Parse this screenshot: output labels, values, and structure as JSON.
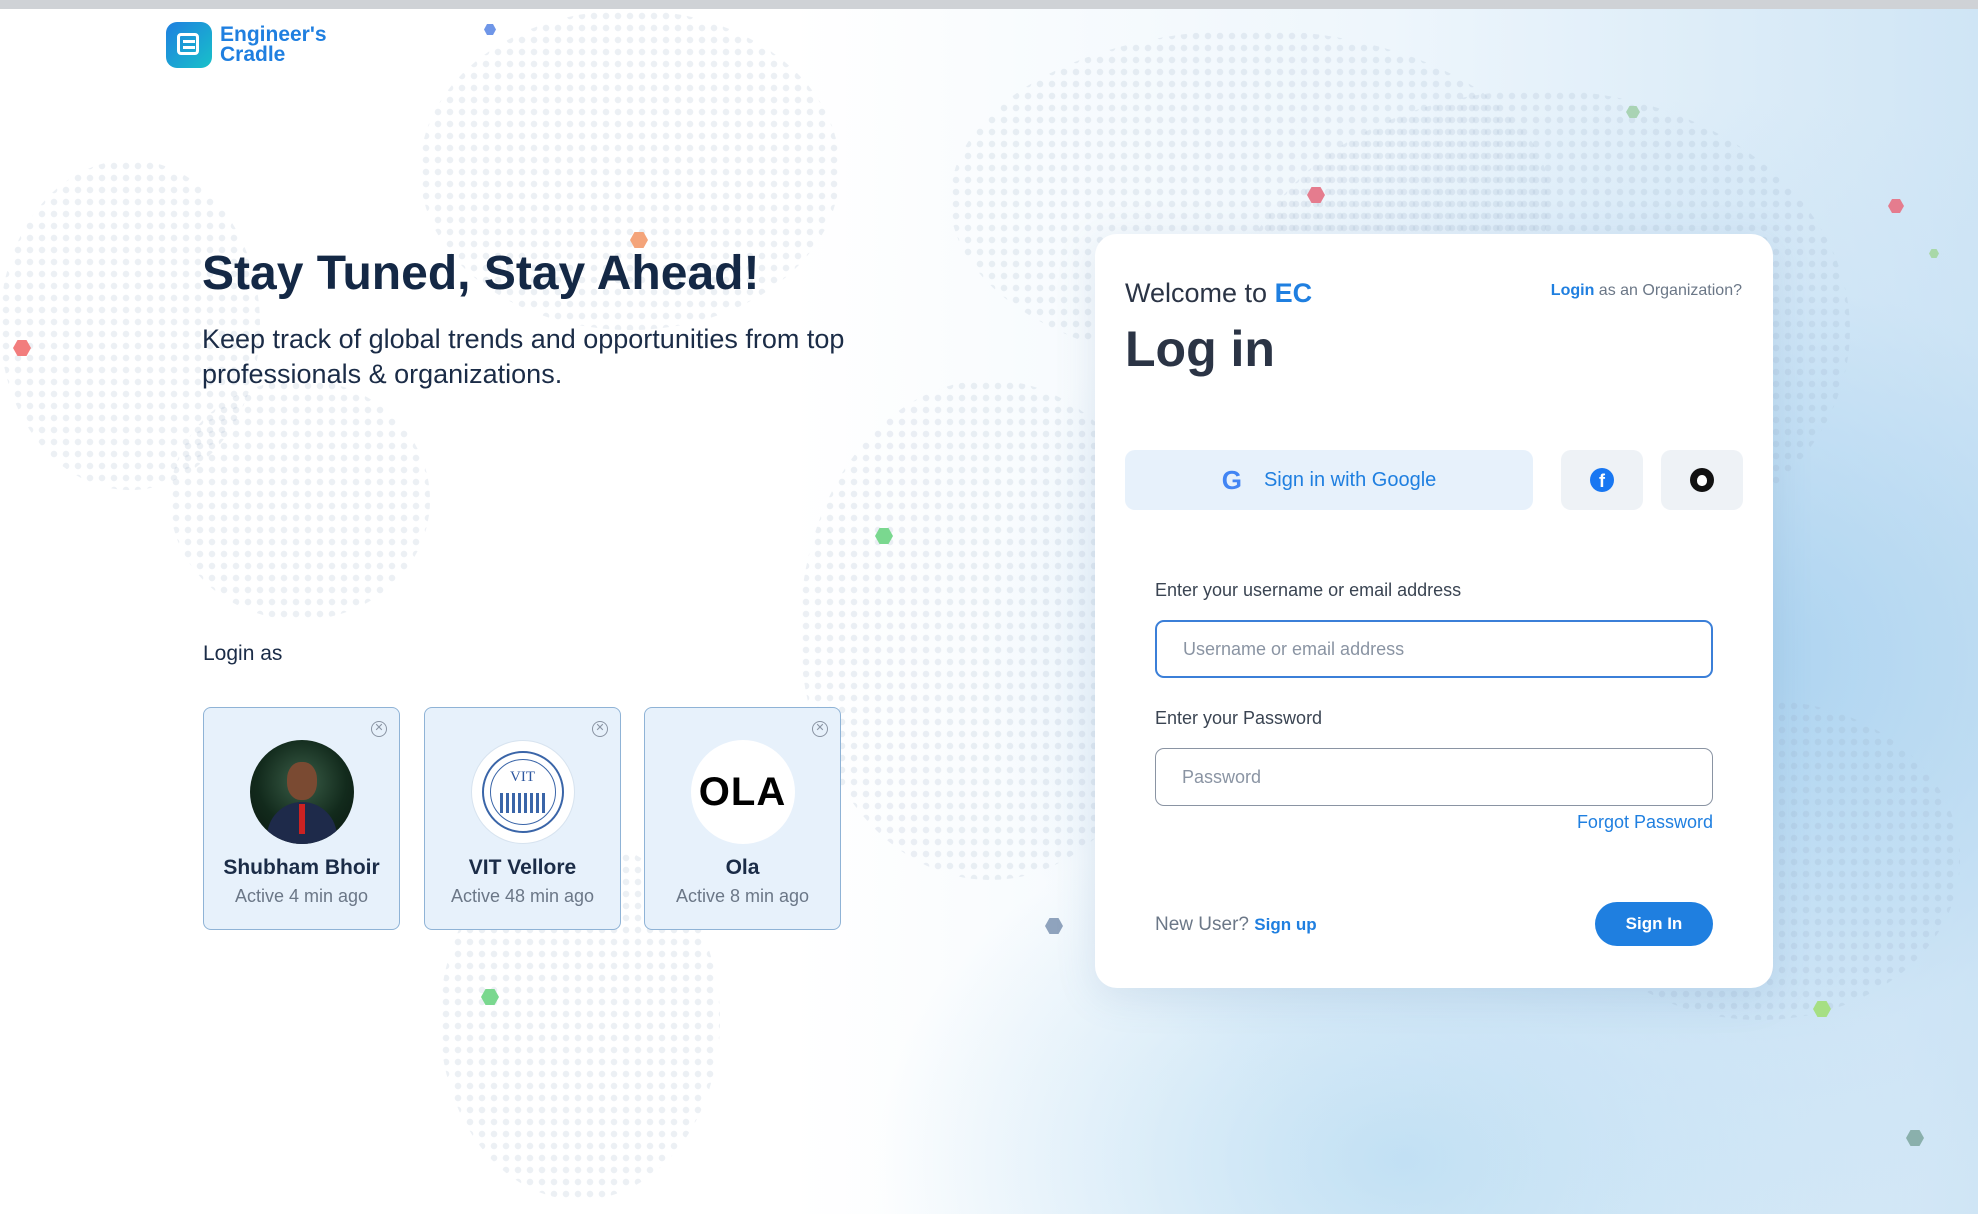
{
  "brand": {
    "name_line1": "Engineer's",
    "name_line2": "Cradle"
  },
  "hero": {
    "title": "Stay Tuned, Stay Ahead!",
    "subtitle": "Keep track of global trends and opportunities from top professionals & organizations."
  },
  "login_as": {
    "label": "Login as",
    "accounts": [
      {
        "name": "Shubham Bhoir",
        "status": "Active 4 min ago"
      },
      {
        "name": "VIT Vellore",
        "status": "Active 48 min ago",
        "logo_text": "VIT"
      },
      {
        "name": "Ola",
        "status": "Active 8 min ago",
        "logo_text": "OLA"
      }
    ]
  },
  "login_card": {
    "welcome_prefix": "Welcome to",
    "welcome_brand": "EC",
    "org_link": "Login",
    "org_suffix": "as an Organization?",
    "title": "Log in",
    "google_label": "Sign in with Google",
    "google_glyph": "G",
    "facebook_glyph": "f",
    "username_label": "Enter your username or email address",
    "username_placeholder": "Username or email address",
    "password_label": "Enter your Password",
    "password_placeholder": "Password",
    "forgot": "Forgot Password",
    "new_user": "New User?",
    "sign_up": "Sign up",
    "sign_in": "Sign In"
  },
  "colors": {
    "accent": "#1f7fe0",
    "title": "#142845",
    "card_bg": "#ffffff",
    "pill_bg": "#e7f1fb"
  },
  "icons": {
    "close": "close-circle-icon",
    "google": "google-icon",
    "facebook": "facebook-icon",
    "apple": "apple-icon"
  }
}
